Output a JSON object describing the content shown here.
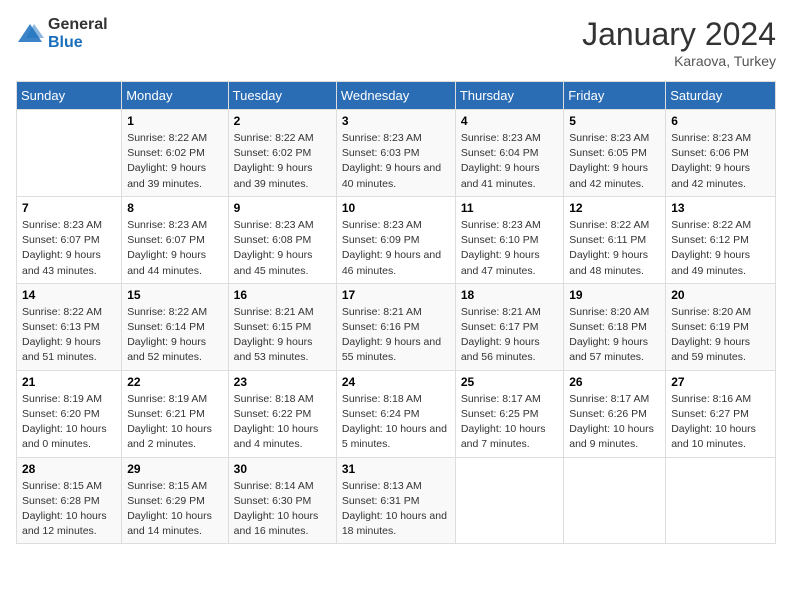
{
  "logo": {
    "general": "General",
    "blue": "Blue"
  },
  "title": {
    "month": "January 2024",
    "location": "Karaova, Turkey"
  },
  "headers": [
    "Sunday",
    "Monday",
    "Tuesday",
    "Wednesday",
    "Thursday",
    "Friday",
    "Saturday"
  ],
  "weeks": [
    [
      {
        "day": "",
        "sunrise": "",
        "sunset": "",
        "daylight": ""
      },
      {
        "day": "1",
        "sunrise": "Sunrise: 8:22 AM",
        "sunset": "Sunset: 6:02 PM",
        "daylight": "Daylight: 9 hours and 39 minutes."
      },
      {
        "day": "2",
        "sunrise": "Sunrise: 8:22 AM",
        "sunset": "Sunset: 6:02 PM",
        "daylight": "Daylight: 9 hours and 39 minutes."
      },
      {
        "day": "3",
        "sunrise": "Sunrise: 8:23 AM",
        "sunset": "Sunset: 6:03 PM",
        "daylight": "Daylight: 9 hours and 40 minutes."
      },
      {
        "day": "4",
        "sunrise": "Sunrise: 8:23 AM",
        "sunset": "Sunset: 6:04 PM",
        "daylight": "Daylight: 9 hours and 41 minutes."
      },
      {
        "day": "5",
        "sunrise": "Sunrise: 8:23 AM",
        "sunset": "Sunset: 6:05 PM",
        "daylight": "Daylight: 9 hours and 42 minutes."
      },
      {
        "day": "6",
        "sunrise": "Sunrise: 8:23 AM",
        "sunset": "Sunset: 6:06 PM",
        "daylight": "Daylight: 9 hours and 42 minutes."
      }
    ],
    [
      {
        "day": "7",
        "sunrise": "Sunrise: 8:23 AM",
        "sunset": "Sunset: 6:07 PM",
        "daylight": "Daylight: 9 hours and 43 minutes."
      },
      {
        "day": "8",
        "sunrise": "Sunrise: 8:23 AM",
        "sunset": "Sunset: 6:07 PM",
        "daylight": "Daylight: 9 hours and 44 minutes."
      },
      {
        "day": "9",
        "sunrise": "Sunrise: 8:23 AM",
        "sunset": "Sunset: 6:08 PM",
        "daylight": "Daylight: 9 hours and 45 minutes."
      },
      {
        "day": "10",
        "sunrise": "Sunrise: 8:23 AM",
        "sunset": "Sunset: 6:09 PM",
        "daylight": "Daylight: 9 hours and 46 minutes."
      },
      {
        "day": "11",
        "sunrise": "Sunrise: 8:23 AM",
        "sunset": "Sunset: 6:10 PM",
        "daylight": "Daylight: 9 hours and 47 minutes."
      },
      {
        "day": "12",
        "sunrise": "Sunrise: 8:22 AM",
        "sunset": "Sunset: 6:11 PM",
        "daylight": "Daylight: 9 hours and 48 minutes."
      },
      {
        "day": "13",
        "sunrise": "Sunrise: 8:22 AM",
        "sunset": "Sunset: 6:12 PM",
        "daylight": "Daylight: 9 hours and 49 minutes."
      }
    ],
    [
      {
        "day": "14",
        "sunrise": "Sunrise: 8:22 AM",
        "sunset": "Sunset: 6:13 PM",
        "daylight": "Daylight: 9 hours and 51 minutes."
      },
      {
        "day": "15",
        "sunrise": "Sunrise: 8:22 AM",
        "sunset": "Sunset: 6:14 PM",
        "daylight": "Daylight: 9 hours and 52 minutes."
      },
      {
        "day": "16",
        "sunrise": "Sunrise: 8:21 AM",
        "sunset": "Sunset: 6:15 PM",
        "daylight": "Daylight: 9 hours and 53 minutes."
      },
      {
        "day": "17",
        "sunrise": "Sunrise: 8:21 AM",
        "sunset": "Sunset: 6:16 PM",
        "daylight": "Daylight: 9 hours and 55 minutes."
      },
      {
        "day": "18",
        "sunrise": "Sunrise: 8:21 AM",
        "sunset": "Sunset: 6:17 PM",
        "daylight": "Daylight: 9 hours and 56 minutes."
      },
      {
        "day": "19",
        "sunrise": "Sunrise: 8:20 AM",
        "sunset": "Sunset: 6:18 PM",
        "daylight": "Daylight: 9 hours and 57 minutes."
      },
      {
        "day": "20",
        "sunrise": "Sunrise: 8:20 AM",
        "sunset": "Sunset: 6:19 PM",
        "daylight": "Daylight: 9 hours and 59 minutes."
      }
    ],
    [
      {
        "day": "21",
        "sunrise": "Sunrise: 8:19 AM",
        "sunset": "Sunset: 6:20 PM",
        "daylight": "Daylight: 10 hours and 0 minutes."
      },
      {
        "day": "22",
        "sunrise": "Sunrise: 8:19 AM",
        "sunset": "Sunset: 6:21 PM",
        "daylight": "Daylight: 10 hours and 2 minutes."
      },
      {
        "day": "23",
        "sunrise": "Sunrise: 8:18 AM",
        "sunset": "Sunset: 6:22 PM",
        "daylight": "Daylight: 10 hours and 4 minutes."
      },
      {
        "day": "24",
        "sunrise": "Sunrise: 8:18 AM",
        "sunset": "Sunset: 6:24 PM",
        "daylight": "Daylight: 10 hours and 5 minutes."
      },
      {
        "day": "25",
        "sunrise": "Sunrise: 8:17 AM",
        "sunset": "Sunset: 6:25 PM",
        "daylight": "Daylight: 10 hours and 7 minutes."
      },
      {
        "day": "26",
        "sunrise": "Sunrise: 8:17 AM",
        "sunset": "Sunset: 6:26 PM",
        "daylight": "Daylight: 10 hours and 9 minutes."
      },
      {
        "day": "27",
        "sunrise": "Sunrise: 8:16 AM",
        "sunset": "Sunset: 6:27 PM",
        "daylight": "Daylight: 10 hours and 10 minutes."
      }
    ],
    [
      {
        "day": "28",
        "sunrise": "Sunrise: 8:15 AM",
        "sunset": "Sunset: 6:28 PM",
        "daylight": "Daylight: 10 hours and 12 minutes."
      },
      {
        "day": "29",
        "sunrise": "Sunrise: 8:15 AM",
        "sunset": "Sunset: 6:29 PM",
        "daylight": "Daylight: 10 hours and 14 minutes."
      },
      {
        "day": "30",
        "sunrise": "Sunrise: 8:14 AM",
        "sunset": "Sunset: 6:30 PM",
        "daylight": "Daylight: 10 hours and 16 minutes."
      },
      {
        "day": "31",
        "sunrise": "Sunrise: 8:13 AM",
        "sunset": "Sunset: 6:31 PM",
        "daylight": "Daylight: 10 hours and 18 minutes."
      },
      {
        "day": "",
        "sunrise": "",
        "sunset": "",
        "daylight": ""
      },
      {
        "day": "",
        "sunrise": "",
        "sunset": "",
        "daylight": ""
      },
      {
        "day": "",
        "sunrise": "",
        "sunset": "",
        "daylight": ""
      }
    ]
  ]
}
